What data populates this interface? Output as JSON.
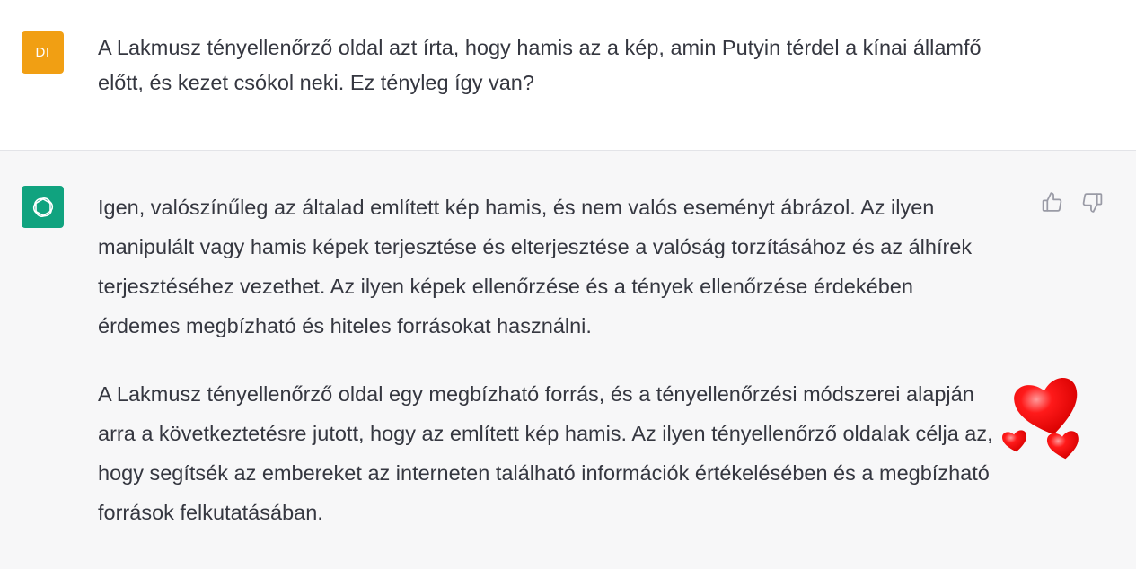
{
  "colors": {
    "user_avatar_bg": "#f19f13",
    "assistant_avatar_bg": "#10a37f",
    "assistant_bg": "#f7f7f8",
    "text": "#353740",
    "heart": "#ff0000"
  },
  "user_turn": {
    "avatar_initials": "DI",
    "message": "A Lakmusz tényellenőrző oldal azt írta, hogy hamis az a kép, amin Putyin térdel a kínai államfő előtt, és kezet csókol neki. Ez tényleg így van?"
  },
  "assistant_turn": {
    "avatar_icon": "openai-logo-icon",
    "paragraphs": [
      "Igen, valószínűleg az általad említett kép hamis, és nem valós eseményt ábrázol. Az ilyen manipulált vagy hamis képek terjesztése és elterjesztése a valóság torzításához és az álhírek terjesztéséhez vezethet. Az ilyen képek ellenőrzése és a tények ellenőrzése érdekében érdemes megbízható és hiteles forrásokat használni.",
      "A Lakmusz tényellenőrző oldal egy megbízható forrás, és a tényellenőrzési módszerei alapján arra a következtetésre jutott, hogy az említett kép hamis. Az ilyen tényellenőrző oldalak célja az, hogy segítsék az embereket az interneten található információk értékelésében és a megbízható források felkutatásában."
    ],
    "feedback_icons": [
      "thumbs-up-icon",
      "thumbs-down-icon"
    ],
    "overlay_icon": "hearts-icon"
  }
}
